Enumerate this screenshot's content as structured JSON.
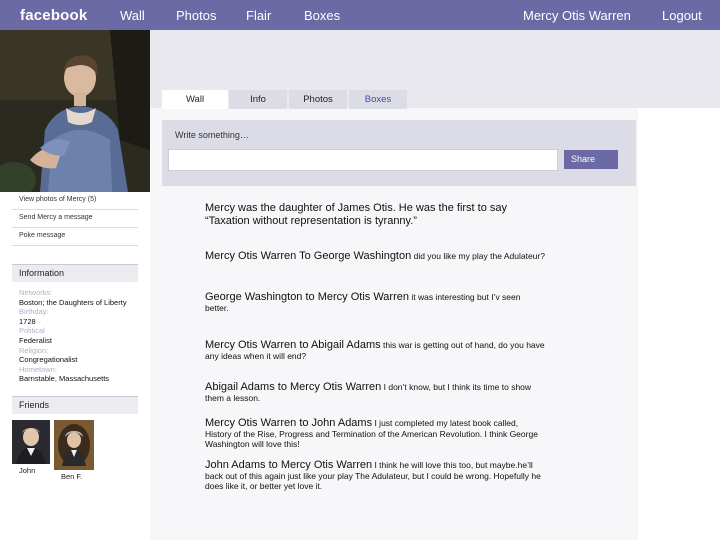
{
  "topbar": {
    "logo": "facebook",
    "nav": [
      "Wall",
      "Photos",
      "Flair",
      "Boxes"
    ],
    "user_name": "Mercy Otis Warren",
    "logout": "Logout"
  },
  "left": {
    "links": [
      "View photos of Mercy (5)",
      "Send Mercy a message",
      "Poke message"
    ],
    "information_header": "Information",
    "info": [
      {
        "label": "Networks:",
        "value": "Boston; the Daughters of Liberty"
      },
      {
        "label": "Birthday:",
        "value": "1728"
      },
      {
        "label": "Political",
        "value": "Federalist"
      },
      {
        "label": "Religion:",
        "value": "Congregationalist"
      },
      {
        "label": "Hometown:",
        "value": "Barnstable, Massachusetts"
      }
    ],
    "friends_header": "Friends",
    "friends": [
      "John",
      "Ben F."
    ]
  },
  "tabs": [
    "Wall",
    "Info",
    "Photos",
    "Boxes"
  ],
  "composer": {
    "label": "Write something…",
    "value": "",
    "share": "Share"
  },
  "posts": [
    {
      "who": "",
      "text": "Mercy was the daughter of James Otis. He was the first to say “Taxation  without representation is tyranny.”"
    },
    {
      "who": " Mercy Otis Warren To George Washington",
      "text": " did you like my play the Adulateur?"
    },
    {
      "who": "George Washington to Mercy Otis Warren",
      "text": " it was interesting but I’v seen better."
    },
    {
      "who": "Mercy Otis Warren to Abigail Adams",
      "text": " this war is getting out of hand, do you have any ideas when it will end?"
    },
    {
      "who": "Abigail Adams to Mercy Otis Warren",
      "text": " I don’t know, but I think its time to show them a lesson."
    },
    {
      "who": "Mercy Otis Warren to John Adams",
      "text": " I just completed my latest book called, History of the Rise, Progress and Termination of the American Revolution. I think George Washington will love this!"
    },
    {
      "who": "John Adams to Mercy Otis Warren",
      "text": " I think he will love this too, but maybe.he’ll back out of this again just like your play The Adulateur, but I could be wrong. Hopefully he does like it, or better yet love it."
    }
  ],
  "colors": {
    "topbar": "#6b6aa5",
    "accent": "#4a4ab0",
    "panel": "#dcdce6"
  }
}
